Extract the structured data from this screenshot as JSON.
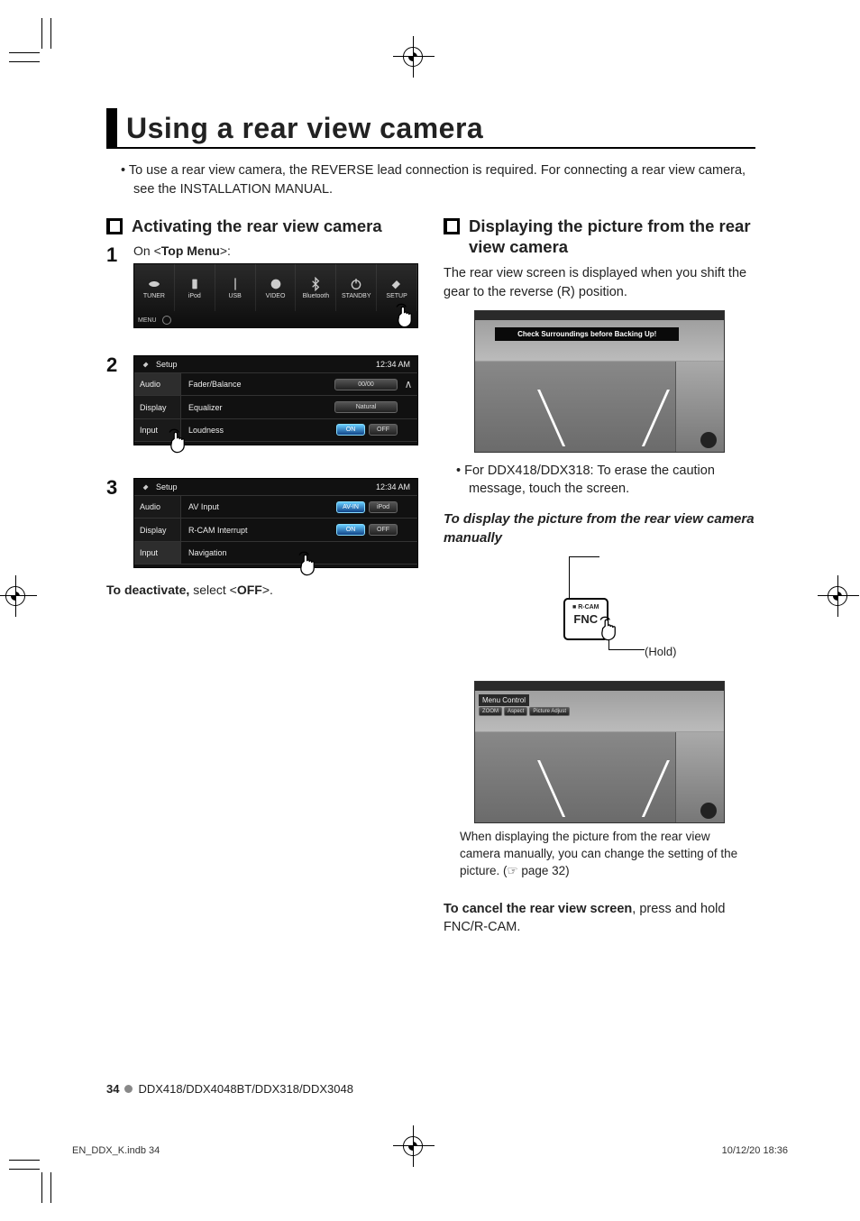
{
  "title": "Using a rear view camera",
  "intro": "To use a rear view camera, the REVERSE lead connection is required. For connecting a rear view camera, see the INSTALLATION MANUAL.",
  "left": {
    "heading": "Activating the rear view camera",
    "step1_prefix": "On <",
    "step1_bold": "Top Menu",
    "step1_suffix": ">:",
    "topmenu": {
      "items": [
        "TUNER",
        "iPod",
        "USB",
        "VIDEO",
        "Bluetooth",
        "STANDBY",
        "SETUP"
      ],
      "menu": "MENU"
    },
    "setup2": {
      "title": "Setup",
      "time": "12:34 AM",
      "tabs": [
        "Audio",
        "Display",
        "Input"
      ],
      "rows": [
        {
          "label": "Fader/Balance",
          "pill": "00/00",
          "wide": true
        },
        {
          "label": "Equalizer",
          "pill": "Natural",
          "wide": true
        },
        {
          "label": "Loudness",
          "on": "ON",
          "off": "OFF"
        }
      ]
    },
    "setup3": {
      "title": "Setup",
      "time": "12:34 AM",
      "tabs": [
        "Audio",
        "Display",
        "Input"
      ],
      "rows": [
        {
          "label": "AV Input",
          "a": "AV-IN",
          "b": "iPod"
        },
        {
          "label": "R-CAM Interrupt",
          "on": "ON",
          "off": "OFF"
        },
        {
          "label": "Navigation"
        }
      ]
    },
    "deact_a": "To deactivate,",
    "deact_b": " select <",
    "deact_c": "OFF",
    "deact_d": ">."
  },
  "right": {
    "heading": "Displaying the picture from the rear view camera",
    "p1": "The rear view screen is displayed when you shift the gear to the reverse (R) position.",
    "cam_banner": "Check Surroundings before Backing Up!",
    "bullet": "For DDX418/DDX318: To erase the caution message, touch the screen.",
    "sub": "To display the picture from the rear view camera manually",
    "fnc_mini": "R-CAM",
    "fnc": "FNC",
    "hold": "(Hold)",
    "menu_control": "Menu Control",
    "menu_pills": [
      "ZOOM",
      "Aspect",
      "Picture Adjust"
    ],
    "note": "When displaying the picture from the rear view camera manually, you can change the setting of the picture. (☞ page 32)",
    "cancel_a": "To cancel the rear view screen",
    "cancel_b": ", press and hold FNC/R-CAM."
  },
  "footer": {
    "page": "34",
    "models": "DDX418/DDX4048BT/DDX318/DDX3048",
    "file": "EN_DDX_K.indb   34",
    "ts": "10/12/20   18:36"
  }
}
